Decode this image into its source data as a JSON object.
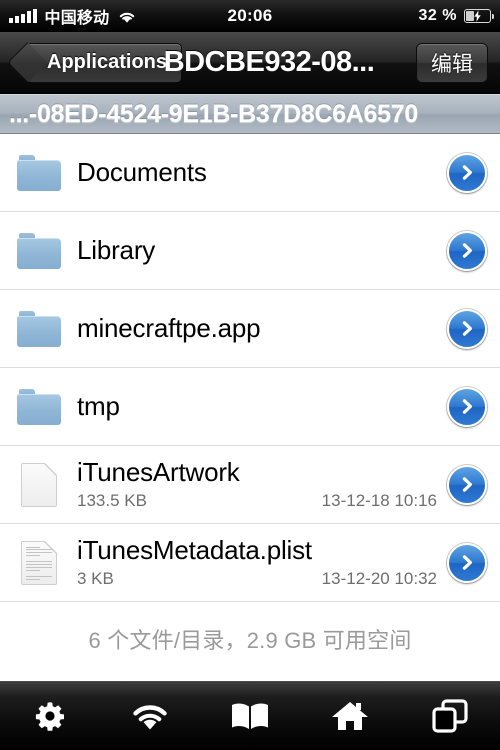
{
  "statusbar": {
    "carrier": "中国移动",
    "signal_bars": 5,
    "wifi_icon": "wifi-icon",
    "time": "20:06",
    "battery_percent": "32 %",
    "battery_icon": "battery-charging-icon"
  },
  "navbar": {
    "back_label": "Applications",
    "title": "BDCBE932-08...",
    "edit_label": "编辑"
  },
  "path_header": {
    "text": "...-08ED-4524-9E1B-B37D8C6A6570"
  },
  "list": {
    "rows": [
      {
        "name": "Documents",
        "kind": "folder",
        "icon": "folder-icon",
        "size": "",
        "date": ""
      },
      {
        "name": "Library",
        "kind": "folder",
        "icon": "folder-icon",
        "size": "",
        "date": ""
      },
      {
        "name": "minecraftpe.app",
        "kind": "folder",
        "icon": "folder-icon",
        "size": "",
        "date": ""
      },
      {
        "name": "tmp",
        "kind": "folder",
        "icon": "folder-icon",
        "size": "",
        "date": ""
      },
      {
        "name": "iTunesArtwork",
        "kind": "file",
        "icon": "blank-document-icon",
        "size": "133.5 KB",
        "date": "13-12-18 10:16"
      },
      {
        "name": "iTunesMetadata.plist",
        "kind": "file",
        "icon": "text-document-icon",
        "size": "3 KB",
        "date": "13-12-20 10:32"
      }
    ],
    "disclosure_icon": "chevron-right-icon",
    "footer": "6 个文件/目录，2.9 GB 可用空间"
  },
  "tabbar": {
    "items": [
      {
        "name": "settings",
        "icon": "gear-icon"
      },
      {
        "name": "network",
        "icon": "wifi-icon"
      },
      {
        "name": "bookmarks",
        "icon": "book-icon"
      },
      {
        "name": "home",
        "icon": "home-icon"
      },
      {
        "name": "windows",
        "icon": "copy-windows-icon"
      }
    ]
  },
  "colors": {
    "accent_blue": "#2e79d0",
    "folder_blue": "#8fb6d6",
    "path_bar": "#a8b2bd",
    "footer_text": "#9a9a9a",
    "separator": "#dcdcdc"
  }
}
